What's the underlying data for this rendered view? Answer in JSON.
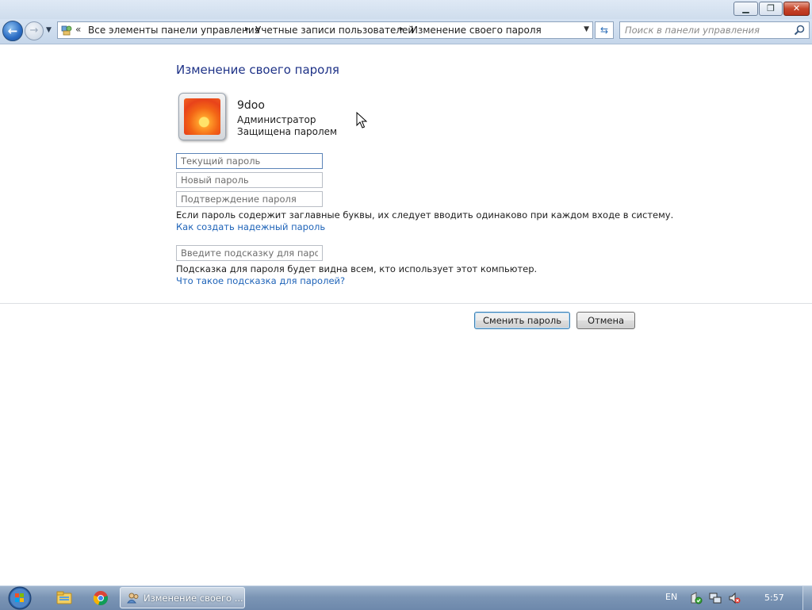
{
  "window": {
    "minimize_icon": "minimize-icon",
    "maximize_icon": "restore-icon",
    "close_icon": "close-icon"
  },
  "navigation": {
    "back_icon": "back-arrow-icon",
    "forward_icon": "forward-arrow-icon",
    "breadcrumb": {
      "chevron": "«",
      "items": [
        "Все элементы панели управления",
        "Учетные записи пользователей",
        "Изменение своего пароля"
      ],
      "separator": "▸"
    },
    "search_placeholder": "Поиск в панели управления"
  },
  "page": {
    "title": "Изменение своего пароля",
    "user": {
      "name": "9doo",
      "role": "Администратор",
      "status": "Защищена паролем"
    },
    "fields": {
      "current_password_placeholder": "Текущий пароль",
      "new_password_placeholder": "Новый пароль",
      "confirm_password_placeholder": "Подтверждение пароля",
      "hint_placeholder": "Введите подсказку для пароля"
    },
    "caps_note": "Если пароль содержит заглавные буквы, их следует вводить одинаково при каждом входе в систему.",
    "strong_password_link": "Как создать надежный пароль",
    "hint_note": "Подсказка для пароля будет видна всем, кто использует этот компьютер.",
    "hint_help_link": "Что такое подсказка для паролей?",
    "buttons": {
      "submit": "Сменить пароль",
      "cancel": "Отмена"
    }
  },
  "taskbar": {
    "active_task_label": "Изменение своего ...",
    "language": "EN",
    "time": "5:57",
    "pinned": [
      "explorer-icon",
      "chrome-icon"
    ],
    "tray_icons": [
      "action-center-icon",
      "network-icon",
      "volume-muted-icon"
    ]
  },
  "colors": {
    "heading": "#1e3287",
    "link": "#1e63b8",
    "taskbar": "#7b95b5"
  }
}
